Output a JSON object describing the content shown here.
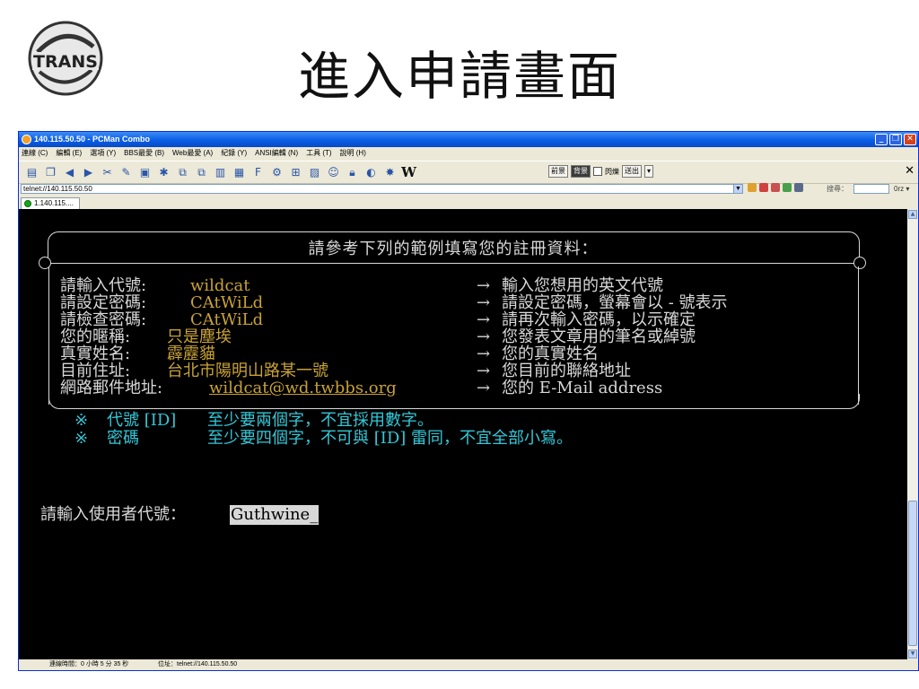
{
  "slide": {
    "title": "進入申請畫面",
    "logo_text": "TRANS"
  },
  "window": {
    "title": "140.115.50.50 - PCMan Combo",
    "menu": [
      "連線 (C)",
      "編輯 (E)",
      "選項 (Y)",
      "BBS最愛 (B)",
      "Web最愛 (A)",
      "紀錄 (Y)",
      "ANSI編輯 (N)",
      "工具 (T)",
      "說明 (H)"
    ],
    "toolbar": {
      "fg_label": "前景",
      "bg_label": "背景",
      "blink_label": "閃爍",
      "send_label": "送出"
    },
    "address": "telnet://140.115.50.50",
    "search_label": "搜尋：",
    "search_option": "0rz",
    "tab_label": "1.140.115...."
  },
  "terminal": {
    "heading": "請參考下列的範例填寫您的註冊資料：",
    "rows": [
      {
        "label": "請輸入代號:",
        "value": "wildcat",
        "desc": "輸入您想用的英文代號"
      },
      {
        "label": "請設定密碼:",
        "value": "CAtWiLd",
        "desc": "請設定密碼，螢幕會以 - 號表示"
      },
      {
        "label": "請檢查密碼:",
        "value": "CAtWiLd",
        "desc": "請再次輸入密碼，以示確定"
      },
      {
        "label": "您的暱稱:",
        "value": "只是塵埃",
        "desc": "您發表文章用的筆名或綽號"
      },
      {
        "label": "真實姓名:",
        "value": "霹靂貓",
        "desc": "您的真實姓名"
      },
      {
        "label": "目前住址:",
        "value": "台北市陽明山路某一號",
        "desc": "您目前的聯絡地址"
      },
      {
        "label": "網路郵件地址:",
        "value": "wildcat@wd.twbbs.org",
        "desc": "您的 E-Mail address"
      }
    ],
    "arrow": "→",
    "notes": [
      {
        "mark": "※",
        "key": "代號 [ID]",
        "text": "至少要兩個字，不宜採用數字。"
      },
      {
        "mark": "※",
        "key": "密碼",
        "text": "至少要四個字，不可與 [ID] 雷同，不宜全部小寫。"
      }
    ],
    "prompt_label": "請輸入使用者代號：",
    "prompt_value": "Guthwine_"
  },
  "status": {
    "connection_time": "連線時間：0 小時 5 分 35 秒",
    "location": "位址：telnet://140.115.50.50"
  },
  "colors": {
    "terminal_bg": "#000000",
    "terminal_text": "#d8d8d8",
    "example_value": "#c8a236",
    "note_text": "#33c8d8",
    "titlebar": "#0a5ee6"
  }
}
